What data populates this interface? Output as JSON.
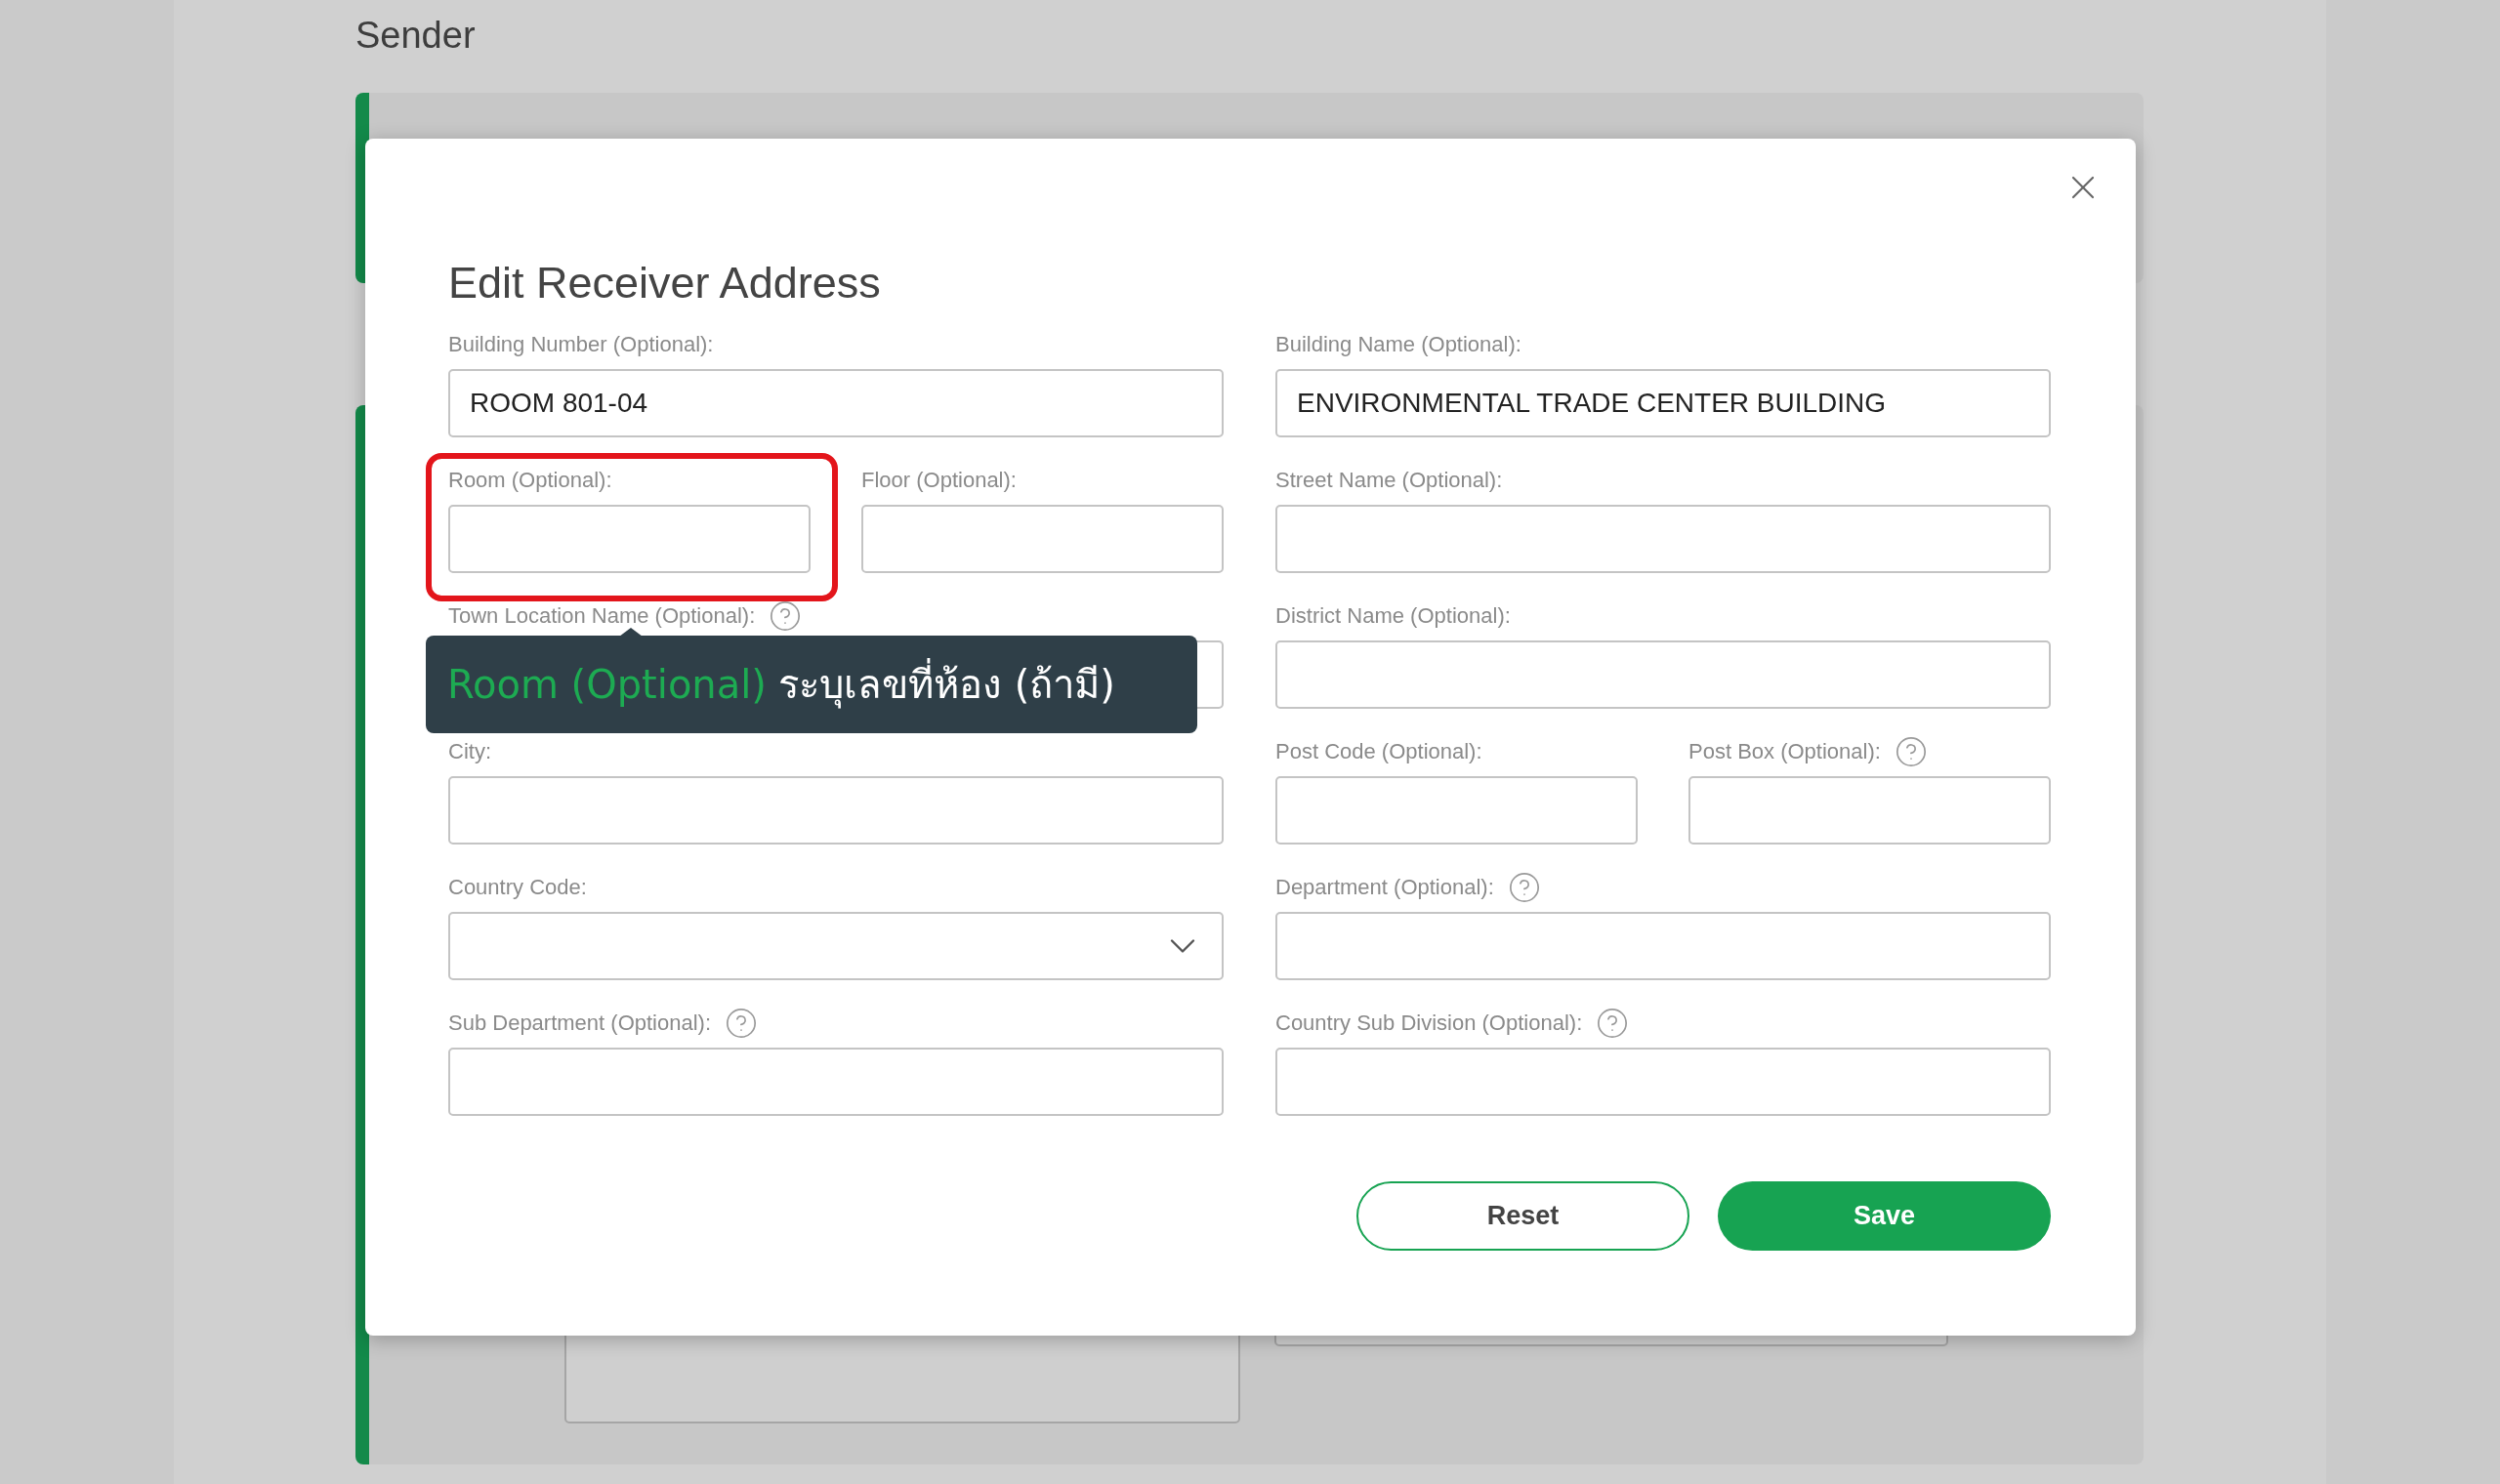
{
  "background": {
    "section_title": "Sender"
  },
  "dialog": {
    "title": "Edit Receiver Address",
    "rows": [
      {
        "left": [
          {
            "kind": "text",
            "label": "Building Number (Optional):",
            "value": "ROOM 801-04",
            "help": false,
            "highlighted": false
          }
        ],
        "right": [
          {
            "kind": "text",
            "label": "Building Name (Optional):",
            "value": "ENVIRONMENTAL TRADE CENTER BUILDING",
            "help": false,
            "highlighted": false
          }
        ]
      },
      {
        "left": [
          {
            "kind": "text",
            "label": "Room (Optional):",
            "help": false,
            "highlighted": true
          },
          {
            "kind": "text",
            "label": "Floor (Optional):",
            "help": false,
            "highlighted": false
          }
        ],
        "right": [
          {
            "kind": "text",
            "label": "Street Name (Optional):",
            "help": false,
            "highlighted": false
          }
        ]
      },
      {
        "left": [
          {
            "kind": "text",
            "label": "Town Location Name (Optional):",
            "help": true,
            "highlighted": false
          }
        ],
        "right": [
          {
            "kind": "text",
            "label": "District Name (Optional):",
            "help": false,
            "highlighted": false
          }
        ]
      },
      {
        "left": [
          {
            "kind": "text",
            "label": "City:",
            "help": false,
            "highlighted": false
          }
        ],
        "right": [
          {
            "kind": "text",
            "label": "Post Code (Optional):",
            "help": false,
            "highlighted": false
          },
          {
            "kind": "text",
            "label": "Post Box (Optional):",
            "help": true,
            "highlighted": false
          }
        ]
      },
      {
        "left": [
          {
            "kind": "select",
            "label": "Country Code:",
            "help": false,
            "highlighted": false
          }
        ],
        "right": [
          {
            "kind": "text",
            "label": "Department (Optional):",
            "help": true,
            "highlighted": false
          }
        ]
      },
      {
        "left": [
          {
            "kind": "text",
            "label": "Sub Department (Optional):",
            "help": true,
            "highlighted": false
          }
        ],
        "right": [
          {
            "kind": "text",
            "label": "Country Sub Division (Optional):",
            "help": true,
            "highlighted": false
          }
        ]
      }
    ],
    "buttons": [
      {
        "kind": "outline",
        "label": "Reset"
      },
      {
        "kind": "primary",
        "label": "Save"
      }
    ]
  },
  "tooltip": {
    "term": "Room (Optional)",
    "description": "ระบุเลขที่ห้อง (ถ้ามี)"
  }
}
